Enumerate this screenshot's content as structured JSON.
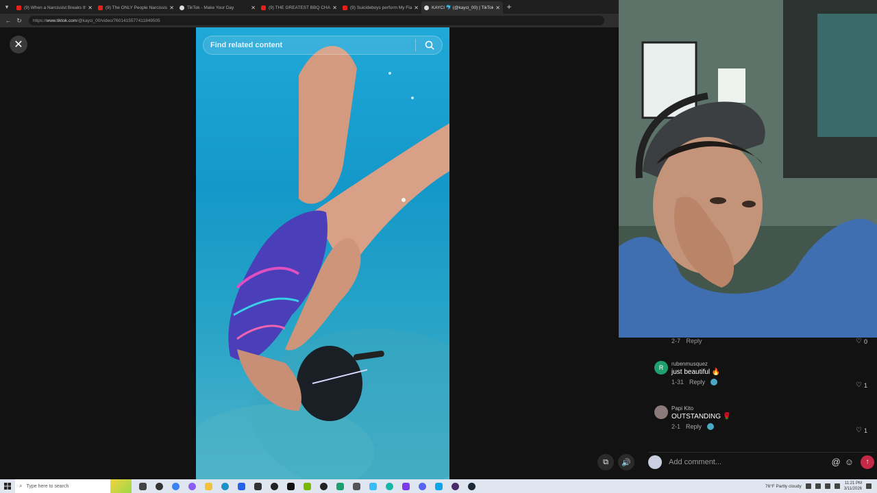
{
  "browser": {
    "tabs": [
      {
        "label": "(9) When a Narcissist Breaks the",
        "icon": "youtube-icon",
        "active": false
      },
      {
        "label": "(9) The ONLY People Narcissists",
        "icon": "youtube-icon",
        "active": false
      },
      {
        "label": "TikTok - Make Your Day",
        "icon": "tiktok-icon",
        "active": false
      },
      {
        "label": "(9) THE GREATEST BBQ CHALLEN",
        "icon": "youtube-icon",
        "active": false
      },
      {
        "label": "(9) Suicideboys perform My Flaw",
        "icon": "youtube-icon",
        "active": false
      },
      {
        "label": "KAYCI 🐬 (@kayci_00) | TikTok",
        "icon": "tiktok-icon",
        "active": true
      }
    ],
    "url_host": "www.tiktok.com",
    "url_prefix": "https://",
    "url_path": "/@kayci_00/video/7601415577411849505"
  },
  "viewer": {
    "search_placeholder": "Find related content"
  },
  "comments": {
    "top_partial": {
      "date": "2-7",
      "reply": "Reply",
      "likes": "0"
    },
    "items": [
      {
        "user": "rubenmusquez",
        "avatar_letter": "R",
        "avatar_color": "#1f9e6e",
        "text": "just beautiful 🔥",
        "date": "1-31",
        "reply": "Reply",
        "likes": "1"
      },
      {
        "user": "Papi Kito",
        "avatar_letter": "",
        "avatar_color": "#8a7a7a",
        "text": "OUTSTANDING 🌹",
        "date": "2-1",
        "reply": "Reply",
        "likes": "1"
      }
    ],
    "input_placeholder": "Add comment...",
    "at_symbol": "@"
  },
  "taskbar": {
    "search_placeholder": "Type here to search",
    "weather": "76°F  Partly cloudy",
    "time": "11:21 PM",
    "date": "3/11/2026"
  },
  "colors": {
    "water_top": "#1ea8d8",
    "send_button": "#c42a47",
    "brand_red": "#e62117"
  }
}
